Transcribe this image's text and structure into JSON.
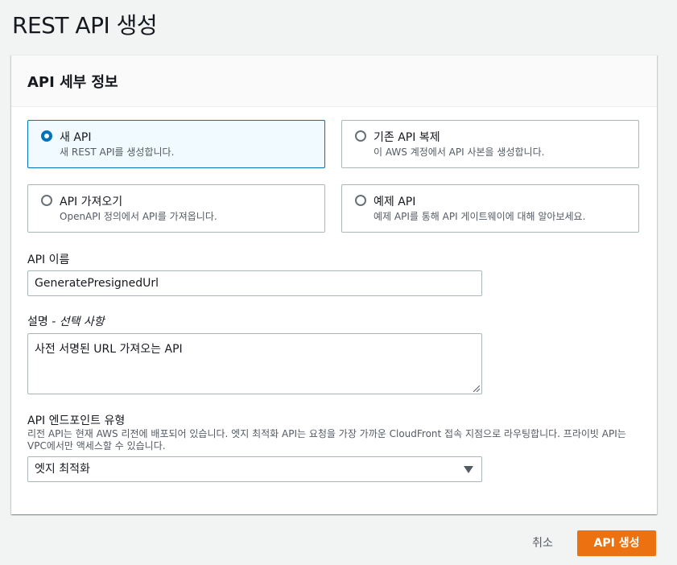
{
  "page": {
    "title": "REST API 생성"
  },
  "panel": {
    "title": "API 세부 정보"
  },
  "options": [
    {
      "label": "새 API",
      "description": "새 REST API를 생성합니다.",
      "selected": true
    },
    {
      "label": "기존 API 복제",
      "description": "이 AWS 계정에서 API 사본을 생성합니다.",
      "selected": false
    },
    {
      "label": "API 가져오기",
      "description": "OpenAPI 정의에서 API를 가져옵니다.",
      "selected": false
    },
    {
      "label": "예제 API",
      "description": "예제 API를 통해 API 게이트웨이에 대해 알아보세요.",
      "selected": false
    }
  ],
  "api_name": {
    "label": "API 이름",
    "value": "GeneratePresignedUrl"
  },
  "description": {
    "label": "설명",
    "optional": " - 선택 사항",
    "value": "사전 서명된 URL 가져오는 API"
  },
  "endpoint_type": {
    "label": "API 엔드포인트 유형",
    "help": "리전 API는 현재 AWS 리전에 배포되어 있습니다. 엣지 최적화 API는 요청을 가장 가까운 CloudFront 접속 지점으로 라우팅합니다. 프라이빗 API는 VPC에서만 액세스할 수 있습니다.",
    "selected": "엣지 최적화"
  },
  "footer": {
    "cancel_label": "취소",
    "create_label": "API 생성"
  },
  "colors": {
    "accent": "#0073bb",
    "primary_button": "#ec7211"
  }
}
